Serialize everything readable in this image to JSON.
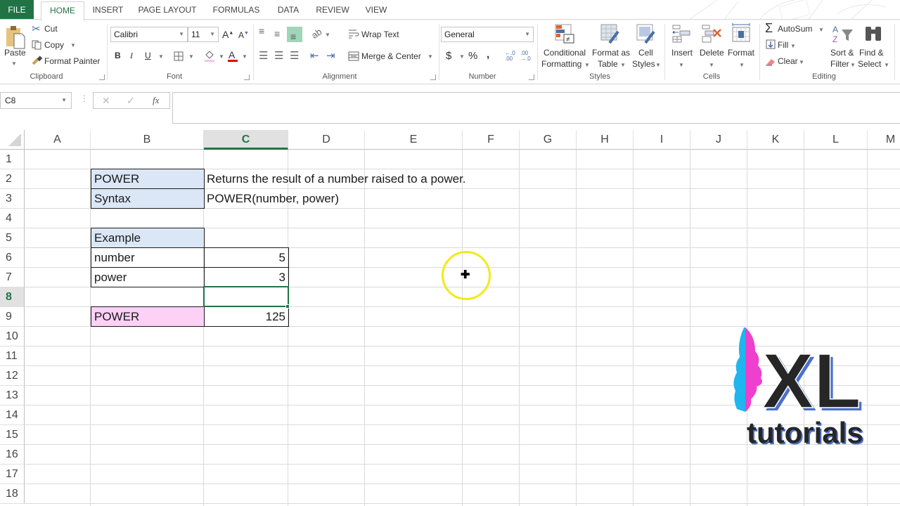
{
  "ribbon_tabs": [
    {
      "label": "FILE"
    },
    {
      "label": "HOME",
      "active": true
    },
    {
      "label": "INSERT"
    },
    {
      "label": "PAGE LAYOUT"
    },
    {
      "label": "FORMULAS"
    },
    {
      "label": "DATA"
    },
    {
      "label": "REVIEW"
    },
    {
      "label": "VIEW"
    }
  ],
  "clipboard": {
    "paste": "Paste",
    "cut": "Cut",
    "copy": "Copy",
    "format_painter": "Format Painter",
    "group": "Clipboard"
  },
  "font": {
    "name": "Calibri",
    "size": "11",
    "bold": "B",
    "italic": "I",
    "underline": "U",
    "group": "Font",
    "fill_color": "#f3c6f0",
    "font_color": "#e00000"
  },
  "alignment": {
    "wrap_text": "Wrap Text",
    "merge_center": "Merge & Center",
    "group": "Alignment"
  },
  "number": {
    "format": "General",
    "currency": "$",
    "percent": "%",
    "comma": ",",
    "inc_decimal": "←.0 .00",
    "dec_decimal": ".00 →.0",
    "group": "Number"
  },
  "styles": {
    "conditional_1": "Conditional",
    "conditional_2": "Formatting",
    "table_1": "Format as",
    "table_2": "Table",
    "cell_1": "Cell",
    "cell_2": "Styles",
    "group": "Styles"
  },
  "cells": {
    "insert": "Insert",
    "delete": "Delete",
    "format": "Format",
    "group": "Cells"
  },
  "editing": {
    "autosum": "AutoSum",
    "fill": "Fill",
    "clear": "Clear",
    "sort_1": "Sort &",
    "sort_2": "Filter",
    "find_1": "Find &",
    "find_2": "Select",
    "group": "Editing"
  },
  "formula_bar": {
    "name_box": "C8",
    "cancel": "✕",
    "enter": "✓",
    "fx": "fx",
    "value": ""
  },
  "columns": [
    "A",
    "B",
    "C",
    "D",
    "E",
    "F",
    "G",
    "H",
    "I",
    "J",
    "K",
    "L",
    "M"
  ],
  "selected_column": "C",
  "rows": [
    "1",
    "2",
    "3",
    "4",
    "5",
    "6",
    "7",
    "8",
    "9",
    "10",
    "11",
    "12",
    "13",
    "14",
    "15",
    "16",
    "17",
    "18"
  ],
  "selected_row": "8",
  "sheet": {
    "b2": "POWER",
    "c2": "Returns the result of a number raised to a power.",
    "b3": "Syntax",
    "c3": "POWER(number, power)",
    "b5": "Example",
    "b6": "number",
    "c6": "5",
    "b7": "power",
    "c7": "3",
    "b9": "POWER",
    "c9": "125"
  },
  "logo": {
    "big": "XL",
    "small": "tutorials",
    "color_left": "#1fb5ef",
    "color_right": "#ee3fcf"
  }
}
